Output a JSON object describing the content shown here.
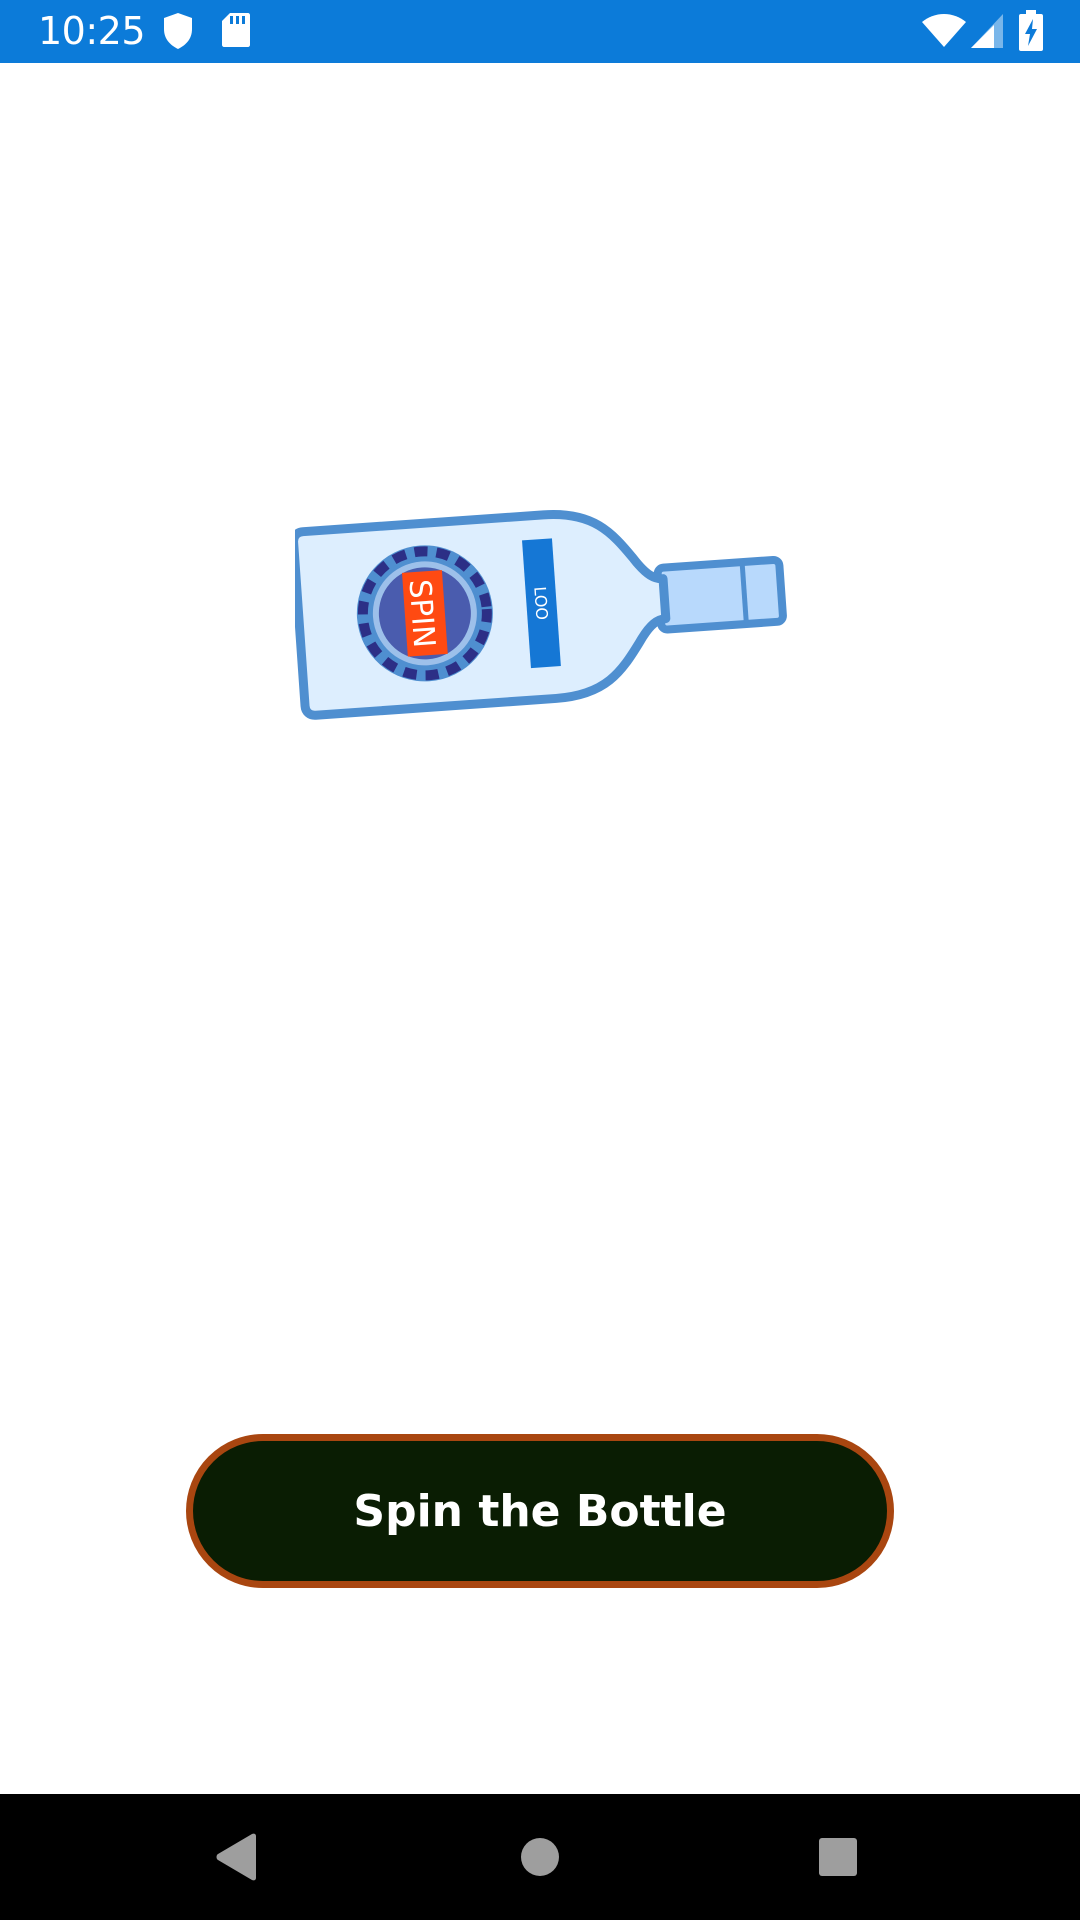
{
  "status_bar": {
    "time": "10:25",
    "background_color": "#0c7bd9",
    "icons": [
      "shield-icon",
      "sd-card-icon",
      "wifi-icon",
      "cell-signal-icon",
      "battery-charging-icon"
    ]
  },
  "bottle": {
    "cap_text": "SPIN",
    "label_text": "LOO",
    "icon": "bottle-icon"
  },
  "main_button": {
    "label": "Spin the Bottle",
    "background_color": "#0a1d03",
    "border_color": "#a94610"
  },
  "nav_bar": {
    "icons": [
      "back-icon",
      "home-icon",
      "recents-icon"
    ]
  }
}
